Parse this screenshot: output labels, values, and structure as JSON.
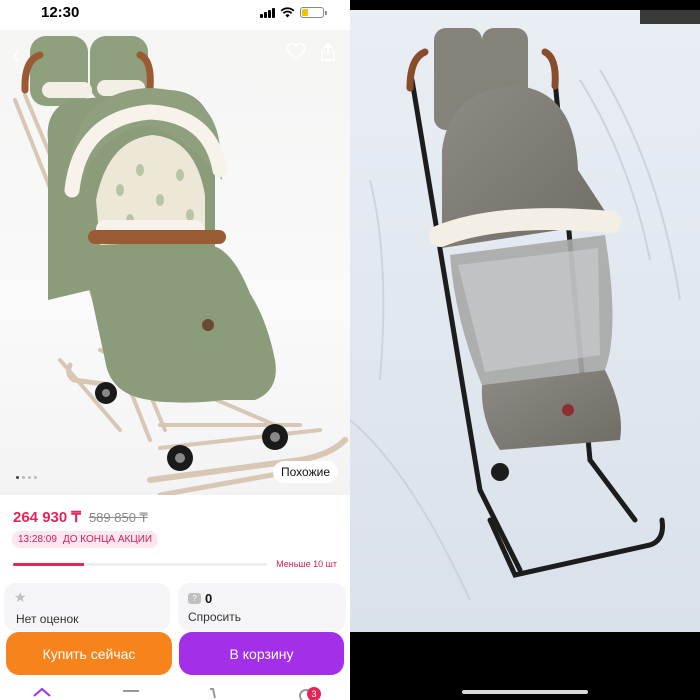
{
  "status_bar": {
    "time": "12:30"
  },
  "product_page": {
    "similar_label": "Похожие",
    "price": "264 930 ₸",
    "old_price": "589 850 ₸",
    "promo_timer": "13:28:09",
    "promo_text": "ДО КОНЦА АКЦИИ",
    "stock_text": "Меньше 10 шт",
    "stock_level": 0.28,
    "rating_label": "Нет оценок",
    "questions_count": "0",
    "ask_label": "Спросить",
    "buy_now_label": "Купить сейчас",
    "add_to_cart_label": "В корзину",
    "cart_badge": "3"
  },
  "colors": {
    "price": "#e6245a",
    "buy_now": "#f7831c",
    "cart": "#a42fe8",
    "promo_bg": "#fde6ee"
  },
  "icons": [
    "back-chevron-icon",
    "heart-icon",
    "share-icon",
    "star-icon",
    "question-icon",
    "home-icon",
    "catalog-icon",
    "cart-icon",
    "profile-icon"
  ]
}
